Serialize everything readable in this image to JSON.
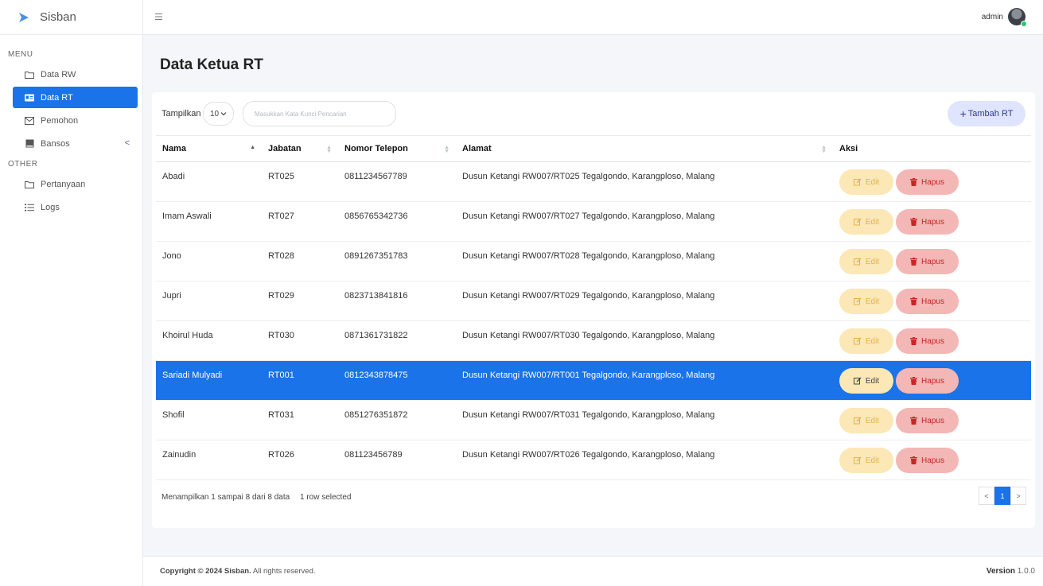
{
  "brand": {
    "name": "Sisban"
  },
  "sidebar": {
    "menu_header": "MENU",
    "other_header": "OTHER",
    "items": [
      {
        "label": "Data RW",
        "icon": "folder-icon"
      },
      {
        "label": "Data RT",
        "icon": "id-card-icon",
        "active": true
      },
      {
        "label": "Pemohon",
        "icon": "envelope-icon"
      },
      {
        "label": "Bansos",
        "icon": "book-icon"
      },
      {
        "label": "Pertanyaan",
        "icon": "folder-icon"
      },
      {
        "label": "Logs",
        "icon": "list-icon"
      }
    ],
    "bansos_chevron": "<"
  },
  "topbar": {
    "user_name": "admin"
  },
  "page": {
    "title": "Data Ketua RT"
  },
  "toolbar": {
    "show_label": "Tampilkan",
    "page_size": "10",
    "search_placeholder": "Masukkan Kata Kunci Pencarian",
    "add_button": "Tambah RT",
    "add_plus": "+"
  },
  "table": {
    "headers": [
      "Nama",
      "Jabatan",
      "Nomor Telepon",
      "Alamat",
      "Aksi"
    ],
    "edit_label": "Edit",
    "delete_label": "Hapus",
    "rows": [
      {
        "nama": "Abadi",
        "jabatan": "RT025",
        "telepon": "0811234567789",
        "alamat": "Dusun Ketangi RW007/RT025 Tegalgondo, Karangploso, Malang"
      },
      {
        "nama": "Imam Aswali",
        "jabatan": "RT027",
        "telepon": "0856765342736",
        "alamat": "Dusun Ketangi RW007/RT027 Tegalgondo, Karangploso, Malang"
      },
      {
        "nama": "Jono",
        "jabatan": "RT028",
        "telepon": "0891267351783",
        "alamat": "Dusun Ketangi RW007/RT028 Tegalgondo, Karangploso, Malang"
      },
      {
        "nama": "Jupri",
        "jabatan": "RT029",
        "telepon": "0823713841816",
        "alamat": "Dusun Ketangi RW007/RT029 Tegalgondo, Karangploso, Malang"
      },
      {
        "nama": "Khoirul Huda",
        "jabatan": "RT030",
        "telepon": "0871361731822",
        "alamat": "Dusun Ketangi RW007/RT030 Tegalgondo, Karangploso, Malang"
      },
      {
        "nama": "Sariadi Mulyadi",
        "jabatan": "RT001",
        "telepon": "0812343878475",
        "alamat": "Dusun Ketangi RW007/RT001 Tegalgondo, Karangploso, Malang"
      },
      {
        "nama": "Shofil",
        "jabatan": "RT031",
        "telepon": "0851276351872",
        "alamat": "Dusun Ketangi RW007/RT031 Tegalgondo, Karangploso, Malang"
      },
      {
        "nama": "Zainudin",
        "jabatan": "RT026",
        "telepon": "081123456789",
        "alamat": "Dusun Ketangi RW007/RT026 Tegalgondo, Karangploso, Malang"
      }
    ]
  },
  "table_info": {
    "summary": "Menampilkan 1 sampai 8 dari 8 data",
    "selection": "1 row selected"
  },
  "pagination": {
    "prev": "<",
    "current": "1",
    "next": ">"
  },
  "footer": {
    "copyright_prefix": "Copyright © 2024",
    "copyright_brand": "Sisban.",
    "copyright_suffix": "All rights reserved.",
    "version_label": "Version",
    "version_value": "1.0.0"
  },
  "colors": {
    "primary": "#1a73e8",
    "edit_bg": "#fbe8b6",
    "delete_bg": "#f3b7b5",
    "delete_text": "#c62828",
    "add_bg": "#dfe4ff"
  }
}
